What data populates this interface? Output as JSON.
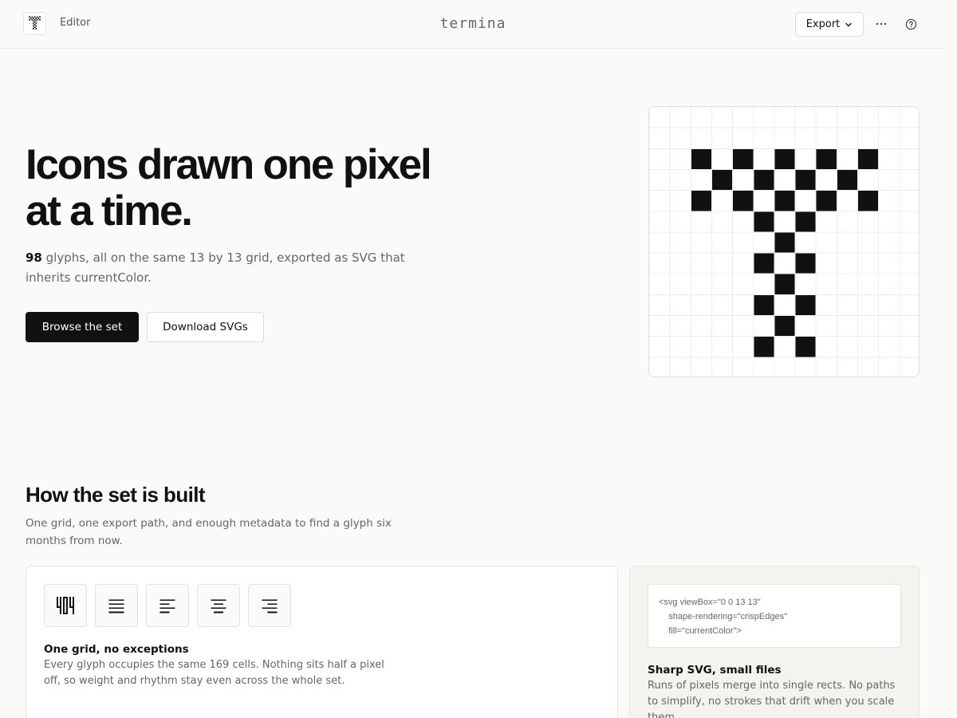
{
  "header": {
    "nav_label": "Editor",
    "brand": "termina",
    "export_label": "Export",
    "icons": [
      "glyph-logo-icon",
      "chevron-down-icon",
      "more-horizontal-icon",
      "help-circle-icon"
    ]
  },
  "hero": {
    "title_line1": "Icons drawn one pixel",
    "title_line2": "at a time.",
    "glyph_count": "98",
    "subtitle_rest": "glyphs, all on the same 13 by 13 grid, exported as SVG that inherits currentColor.",
    "primary_button": "Browse the set",
    "secondary_button": "Download SVGs",
    "grid_size": 13,
    "glyph_cells": [
      [
        2,
        2
      ],
      [
        2,
        4
      ],
      [
        2,
        6
      ],
      [
        2,
        8
      ],
      [
        2,
        10
      ],
      [
        3,
        3
      ],
      [
        3,
        5
      ],
      [
        3,
        7
      ],
      [
        3,
        9
      ],
      [
        4,
        2
      ],
      [
        4,
        4
      ],
      [
        4,
        6
      ],
      [
        4,
        8
      ],
      [
        4,
        10
      ],
      [
        5,
        5
      ],
      [
        5,
        7
      ],
      [
        6,
        6
      ],
      [
        7,
        5
      ],
      [
        7,
        7
      ],
      [
        8,
        6
      ],
      [
        9,
        5
      ],
      [
        9,
        7
      ],
      [
        10,
        6
      ],
      [
        11,
        5
      ],
      [
        11,
        7
      ]
    ]
  },
  "section": {
    "title": "How the set is built",
    "subtitle": "One grid, one export path, and enough metadata to find a glyph six months from now."
  },
  "card_grid": {
    "tiles": [
      "glyph-404-icon",
      "align-justify-icon",
      "align-left-icon",
      "align-center-icon",
      "align-right-icon"
    ],
    "heading": "One grid, no exceptions",
    "text": "Every glyph occupies the same 169 cells. Nothing sits half a pixel off, so weight and rhythm stay even across the whole set."
  },
  "card_svg": {
    "code_lines": [
      "<svg viewBox=\"0 0 13 13\"",
      "    shape-rendering=\"crispEdges\"",
      "    fill=\"currentColor\">"
    ],
    "heading": "Sharp SVG, small files",
    "text": "Runs of pixels merge into single rects. No paths to simplify, no strokes that drift when you scale them."
  },
  "colors": {
    "background": "#fafaf8",
    "ink": "#111111",
    "muted": "#666666",
    "border": "#e3e3de"
  }
}
